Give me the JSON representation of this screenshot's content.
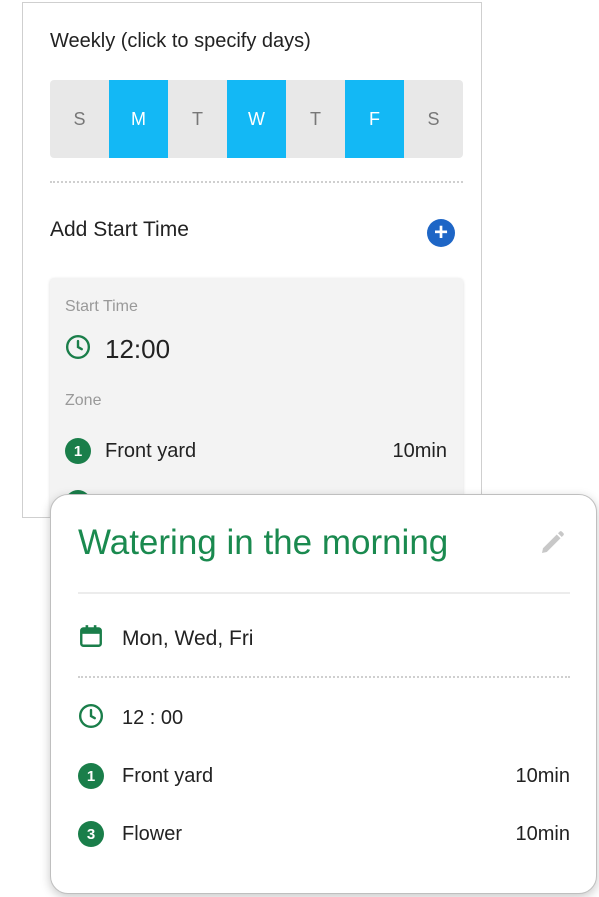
{
  "schedule_editor": {
    "weekly_label": "Weekly (click to specify days)",
    "days": [
      {
        "letter": "S",
        "selected": false
      },
      {
        "letter": "M",
        "selected": true
      },
      {
        "letter": "T",
        "selected": false
      },
      {
        "letter": "W",
        "selected": true
      },
      {
        "letter": "T",
        "selected": false
      },
      {
        "letter": "F",
        "selected": true
      },
      {
        "letter": "S",
        "selected": false
      }
    ],
    "add_start_time_label": "Add Start Time",
    "start_time_caption": "Start Time",
    "start_time_value": "12:00",
    "zone_caption": "Zone",
    "zones": [
      {
        "number": "1",
        "name": "Front yard",
        "duration": "10min"
      }
    ]
  },
  "summary_card": {
    "title": "Watering in the morning",
    "days_text": "Mon, Wed, Fri",
    "time_text": "12 : 00",
    "zones": [
      {
        "number": "1",
        "name": "Front yard",
        "duration": "10min"
      },
      {
        "number": "3",
        "name": "Flower",
        "duration": "10min"
      }
    ]
  },
  "colors": {
    "accent_blue": "#13b8f5",
    "zone_green": "#1a7e4a",
    "title_green": "#1a8a4f",
    "add_button_blue": "#1e66c6"
  },
  "icons": {
    "clock": "clock-icon",
    "calendar": "calendar-icon",
    "edit": "pencil-icon",
    "add": "plus-circle-icon"
  }
}
